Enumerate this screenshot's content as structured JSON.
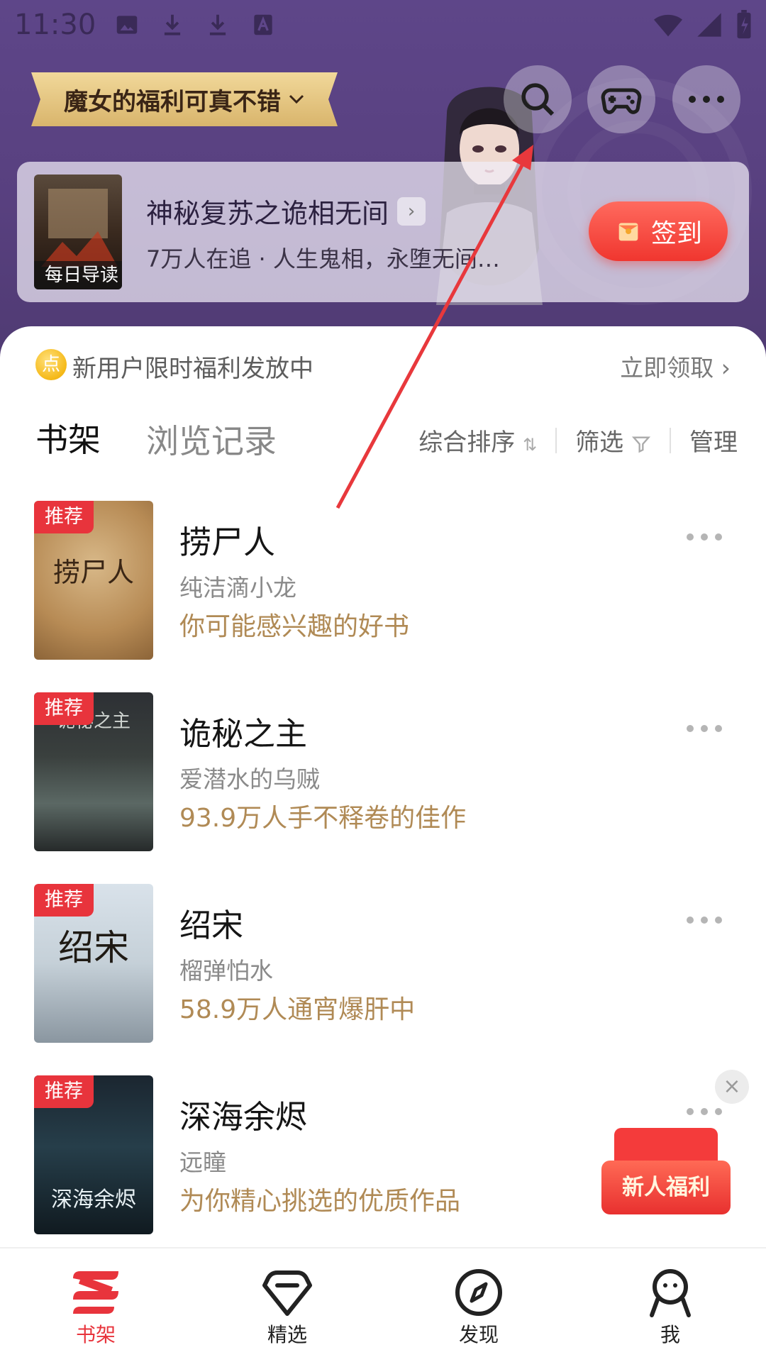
{
  "status_bar": {
    "time": "11:30"
  },
  "header": {
    "campaign_label": "魔女的福利可真不错",
    "daily": {
      "cover_tag": "每日导读",
      "title": "神秘复苏之诡相无间",
      "subtitle": "7万人在追 · 人生鬼相，永堕无间…",
      "signin_label": "签到"
    }
  },
  "promo": {
    "coin": "点",
    "text": "新用户限时福利发放中",
    "action": "立即领取"
  },
  "tabs": {
    "active": "书架",
    "inactive": "浏览记录"
  },
  "tools": {
    "sort": "综合排序",
    "filter": "筛选",
    "manage": "管理"
  },
  "books": [
    {
      "badge": "推荐",
      "title": "捞尸人",
      "author": "纯洁滴小龙",
      "desc": "你可能感兴趣的好书",
      "cover_text": "捞尸人"
    },
    {
      "badge": "推荐",
      "title": "诡秘之主",
      "author": "爱潜水的乌贼",
      "desc": "93.9万人手不释卷的佳作",
      "cover_text": "诡秘之主"
    },
    {
      "badge": "推荐",
      "title": "绍宋",
      "author": "榴弹怕水",
      "desc": "58.9万人通宵爆肝中",
      "cover_text": "绍宋"
    },
    {
      "badge": "推荐",
      "title": "深海余烬",
      "author": "远瞳",
      "desc": "为你精心挑选的优质作品",
      "cover_text": "深海余烬"
    }
  ],
  "welfare": {
    "label": "新人福利",
    "close": "×"
  },
  "nav": [
    {
      "label": "书架",
      "icon": "bookshelf-icon"
    },
    {
      "label": "精选",
      "icon": "diamond-icon"
    },
    {
      "label": "发现",
      "icon": "compass-icon"
    },
    {
      "label": "我",
      "icon": "person-icon"
    }
  ],
  "colors": {
    "accent": "#e8343c",
    "header": "#58407f",
    "gold_text": "#b08a55"
  }
}
